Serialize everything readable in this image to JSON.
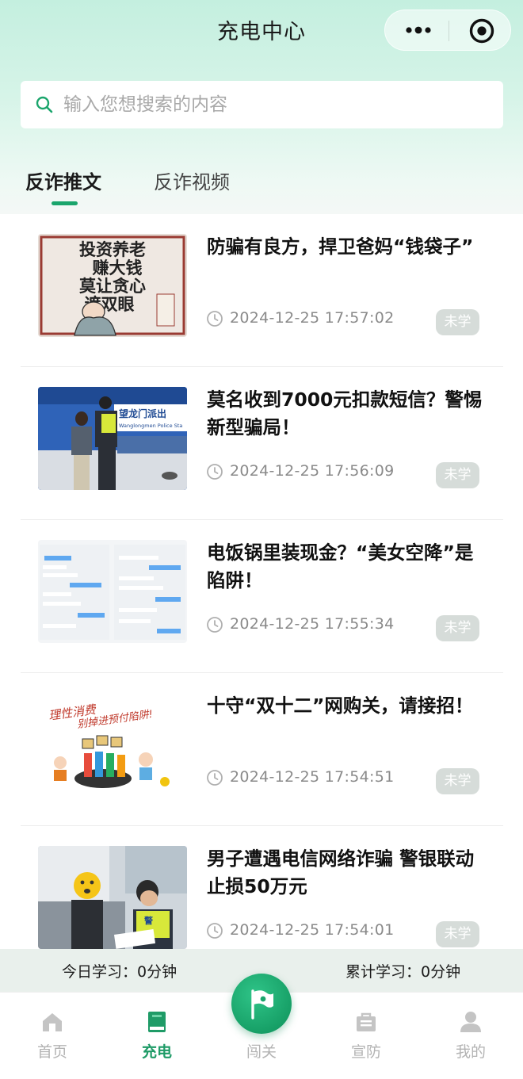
{
  "header": {
    "title": "充电中心"
  },
  "search": {
    "placeholder": "输入您想搜索的内容"
  },
  "tabs": [
    {
      "label": "反诈推文",
      "active": true
    },
    {
      "label": "反诈视频",
      "active": false
    }
  ],
  "articles": [
    {
      "title": "防骗有良方，捍卫爸妈“钱袋子”",
      "time": "2024-12-25 17:57:02",
      "status": "未学",
      "thumb_text": [
        "投资养老",
        "赚大钱",
        "莫让贪心",
        "遮双眼"
      ]
    },
    {
      "title": "莫名收到7000元扣款短信？警惕新型骗局！",
      "time": "2024-12-25 17:56:09",
      "status": "未学",
      "thumb_text": [
        "望龙门派出",
        "Wanglongmen Police Sta"
      ]
    },
    {
      "title": "电饭锅里装现金？“美女空降”是陷阱！",
      "time": "2024-12-25 17:55:34",
      "status": "未学"
    },
    {
      "title": "十守“双十二”网购关，请接招！",
      "time": "2024-12-25 17:54:51",
      "status": "未学",
      "thumb_text": [
        "理性消费",
        "别掉进预付陷阱!"
      ]
    },
    {
      "title": "男子遭遇电信网络诈骗 警银联动止损50万元",
      "time": "2024-12-25 17:54:01",
      "status": "未学",
      "thumb_text": [
        "警"
      ]
    }
  ],
  "study": {
    "today": "今日学习：0分钟",
    "total": "累计学习：0分钟"
  },
  "tabbar": [
    {
      "label": "首页",
      "icon": "home-icon",
      "active": false
    },
    {
      "label": "充电",
      "icon": "book-icon",
      "active": true
    },
    {
      "label": "闯关",
      "icon": "flag-icon",
      "active": false
    },
    {
      "label": "宣防",
      "icon": "briefcase-icon",
      "active": false
    },
    {
      "label": "我的",
      "icon": "user-icon",
      "active": false
    }
  ],
  "colors": {
    "accent": "#1aa56c",
    "header_bg": "#c4efdf",
    "badge_bg": "#d6dcd9"
  }
}
